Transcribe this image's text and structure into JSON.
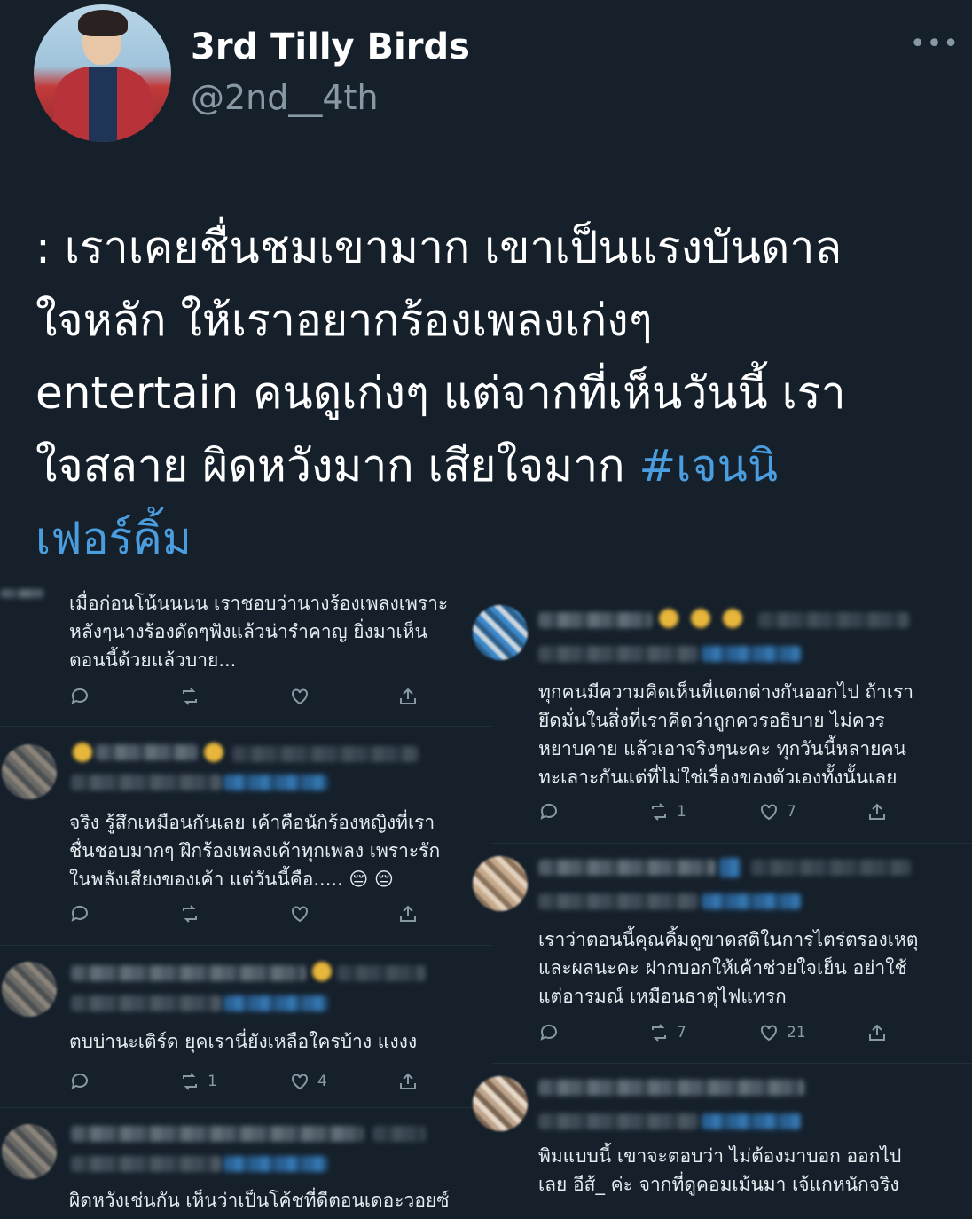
{
  "profile": {
    "name": "3rd Tilly Birds",
    "handle": "@2nd__4th",
    "more_icon": "more-horizontal-icon"
  },
  "tweet": {
    "lines": [
      ": เราเคยชื่นชมเขามาก เขาเป็นแรงบันดาล",
      "ใจหลัก ให้เราอยากร้องเพลงเก่งๆ",
      "entertain คนดูเก่งๆ แต่จากที่เห็นวันนี้ เรา",
      "ใจสลาย ผิดหวังมาก เสียใจมาก "
    ],
    "hashtag_part1": "#เจนนิ",
    "hashtag_part2": "เฟอร์คิ้ม"
  },
  "colors": {
    "background": "#15202b",
    "hashtag": "#4a9ee0",
    "muted": "#8899a6"
  },
  "replies_left": [
    {
      "text": "เมื่อก่อนโน้นนนน  เราชอบว่านางร้องเพลงเพราะ\nหลังๆนางร้องดัดๆฟังแล้วน่ารำคาญ  ยิ่งมาเห็น\nตอนนี้ด้วยแล้วบาย...",
      "retweets": "",
      "likes": ""
    },
    {
      "text": "จริง รู้สึกเหมือนกันเลย เค้าคือนักร้องหญิงที่เรา\nชื่นชอบมากๆ ฝึกร้องเพลงเค้าทุกเพลง เพราะรัก\nในพลังเสียงของเค้า แต่วันนี้คือ..... 😔 😔",
      "retweets": "",
      "likes": ""
    },
    {
      "text": "ตบบ่านะเติร์ด ยุคเรานี่ยังเหลือใครบ้าง แงงง",
      "retweets": "1",
      "likes": "4"
    },
    {
      "text": "ผิดหวังเช่นกัน เห็นว่าเป็นโค้ชที่ดีตอนเดอะวอยซ์",
      "retweets": "",
      "likes": ""
    }
  ],
  "replies_right": [
    {
      "text": "ทุกคนมีความคิดเห็นที่แตกต่างกันออกไป ถ้าเรา\nยึดมั่นในสิ่งที่เราคิดว่าถูกควรอธิบาย ไม่ควร\nหยาบคาย แล้วเอาจริงๆนะคะ ทุกวันนี้หลายคน\nทะเลาะกันแต่ที่ไม่ใช่เรื่องของตัวเองทั้งนั้นเลย",
      "retweets": "1",
      "likes": "7"
    },
    {
      "text": "เราว่าตอนนี้คุณคิ้มดูขาดสติในการไตร่ตรองเหตุ\nและผลนะคะ ฝากบอกให้เค้าช่วยใจเย็น อย่าใช้\nแต่อารมณ์ เหมือนธาตุไฟแทรก",
      "retweets": "7",
      "likes": "21"
    },
    {
      "text": "พิมแบบนี้ เขาจะตอบว่า ไม่ต้องมาบอก ออกไป\nเลย อีส้_ ค่ะ จากที่ดูคอมเม้นมา เจ้แกหนักจริง",
      "retweets": "",
      "likes": ""
    }
  ]
}
